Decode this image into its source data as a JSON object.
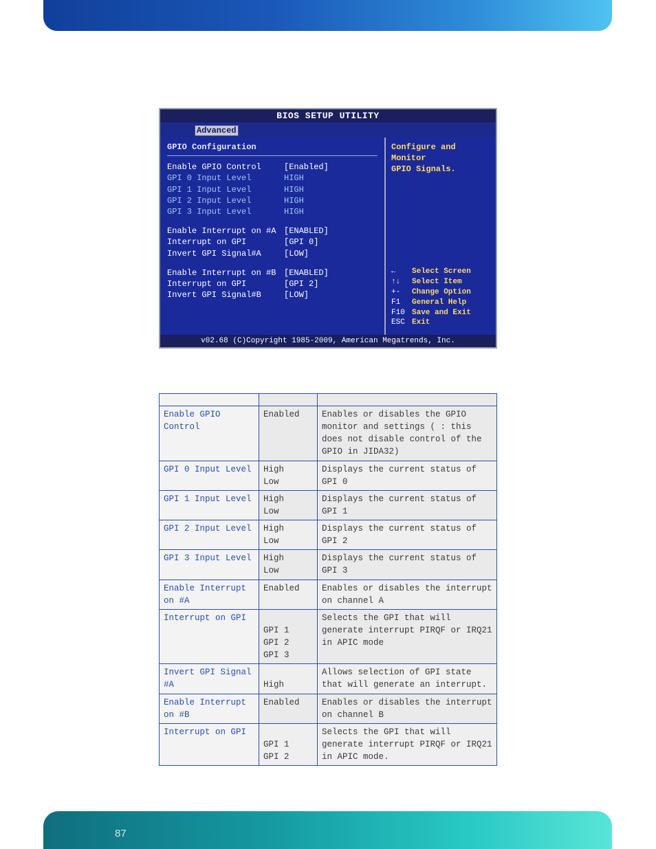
{
  "page_number": "87",
  "bios": {
    "title": "BIOS SETUP UTILITY",
    "tab": "Advanced",
    "heading": "GPIO Configuration",
    "rows_a": [
      {
        "label": "Enable GPIO Control",
        "value": "[Enabled]",
        "white": true
      },
      {
        "label": "GPI 0 Input Level",
        "value": "HIGH"
      },
      {
        "label": "GPI 1 Input Level",
        "value": "HIGH"
      },
      {
        "label": "GPI 2 Input Level",
        "value": "HIGH"
      },
      {
        "label": "GPI 3 Input Level",
        "value": "HIGH"
      }
    ],
    "rows_b": [
      {
        "label": "Enable Interrupt on #A",
        "value": "[ENABLED]",
        "white": true
      },
      {
        "label": "Interrupt on GPI",
        "value": "[GPI 0]",
        "white": true
      },
      {
        "label": "Invert GPI Signal#A",
        "value": "[LOW]",
        "white": true
      }
    ],
    "rows_c": [
      {
        "label": "Enable Interrupt on #B",
        "value": "[ENABLED]",
        "white": true
      },
      {
        "label": "Interrupt on GPI",
        "value": "[GPI 2]",
        "white": true
      },
      {
        "label": "Invert GPI Signal#B",
        "value": "[LOW]",
        "white": true
      }
    ],
    "help_top_1": "Configure and Monitor",
    "help_top_2": "GPIO Signals.",
    "nav": [
      {
        "key": "←",
        "act": "Select Screen"
      },
      {
        "key": "↑↓",
        "act": "Select Item"
      },
      {
        "key": "+-",
        "act": "Change Option"
      },
      {
        "key": "F1",
        "act": "General Help"
      },
      {
        "key": "F10",
        "act": "Save and Exit"
      },
      {
        "key": "ESC",
        "act": "Exit"
      }
    ],
    "footer": "v02.68 (C)Copyright 1985-2009, American Megatrends, Inc."
  },
  "table": {
    "rows": [
      {
        "feature": "Enable  GPIO Control",
        "options": "Enabled",
        "desc": "Enables or disables the GPIO monitor and settings (    : this does not disable control of the GPIO in JIDA32)"
      },
      {
        "feature": "GPI 0 Input Level",
        "options": "High\nLow",
        "desc": "Displays the current status of GPI 0"
      },
      {
        "feature": "GPI 1 Input Level",
        "options": "High\nLow",
        "desc": "Displays the current status of GPI 1"
      },
      {
        "feature": "GPI 2 Input Level",
        "options": "High\nLow",
        "desc": "Displays the current status of GPI 2"
      },
      {
        "feature": "GPI 3 Input Level",
        "options": "High\nLow",
        "desc": "Displays the current status of GPI 3"
      },
      {
        "feature": "Enable Interrupt on #A",
        "options": "Enabled",
        "desc": "Enables or disables the interrupt on channel A"
      },
      {
        "feature": "Interrupt on GPI",
        "options": "\nGPI 1\nGPI 2\nGPI 3",
        "desc": "Selects the GPI that will generate interrupt PIRQF or IRQ21 in APIC mode"
      },
      {
        "feature": "Invert GPI Signal #A",
        "options": "\nHigh",
        "desc": "Allows selection of GPI state that will generate an interrupt."
      },
      {
        "feature": "Enable Interrupt on #B",
        "options": "Enabled",
        "desc": "Enables or disables the interrupt on channel B"
      },
      {
        "feature": "Interrupt on GPI",
        "options": "\nGPI 1\nGPI 2",
        "desc": "Selects the GPI that will generate interrupt PIRQF or IRQ21 in APIC mode."
      }
    ]
  }
}
